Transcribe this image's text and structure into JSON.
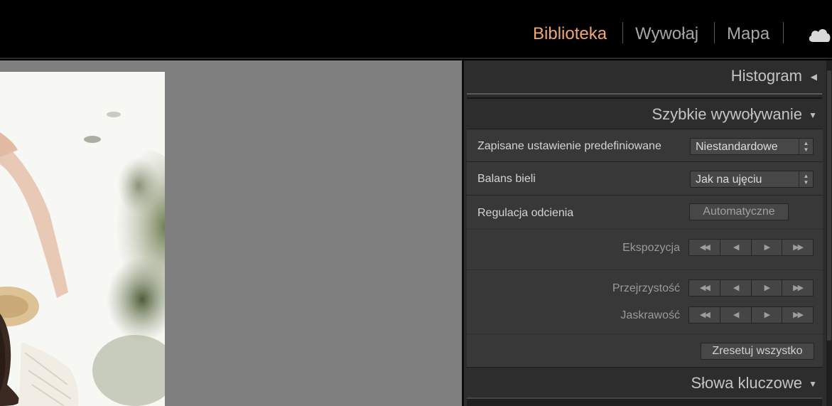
{
  "modules": [
    {
      "label": "Biblioteka",
      "active": true
    },
    {
      "label": "Wywołaj",
      "active": false
    },
    {
      "label": "Mapa",
      "active": false
    }
  ],
  "panels": {
    "histogram": {
      "title": "Histogram",
      "state": "collapsed"
    },
    "quick_develop": {
      "title": "Szybkie wywoływanie",
      "state": "expanded",
      "preset": {
        "label": "Zapisane ustawienie predefiniowane",
        "value": "Niestandardowe"
      },
      "white_balance": {
        "label": "Balans bieli",
        "value": "Jak na ujęciu"
      },
      "tone": {
        "label": "Regulacja odcienia",
        "auto_button": "Automatyczne"
      },
      "exposure": {
        "label": "Ekspozycja"
      },
      "clarity": {
        "label": "Przejrzystość"
      },
      "vibrance": {
        "label": "Jaskrawość"
      },
      "reset_button": "Zresetuj wszystko"
    },
    "keywords": {
      "title": "Słowa kluczowe",
      "state": "expanded"
    }
  },
  "colors": {
    "active_module": "#f0a870",
    "inactive_module": "#a6a6a6",
    "canvas_bg": "#7f7f7f",
    "panel_bg": "#2d2d2d"
  },
  "icons": [
    "cloud-sync-icon",
    "collapsed-triangle-icon",
    "expanded-triangle-icon",
    "double-left-arrow-icon",
    "left-arrow-icon",
    "right-arrow-icon",
    "double-right-arrow-icon"
  ]
}
